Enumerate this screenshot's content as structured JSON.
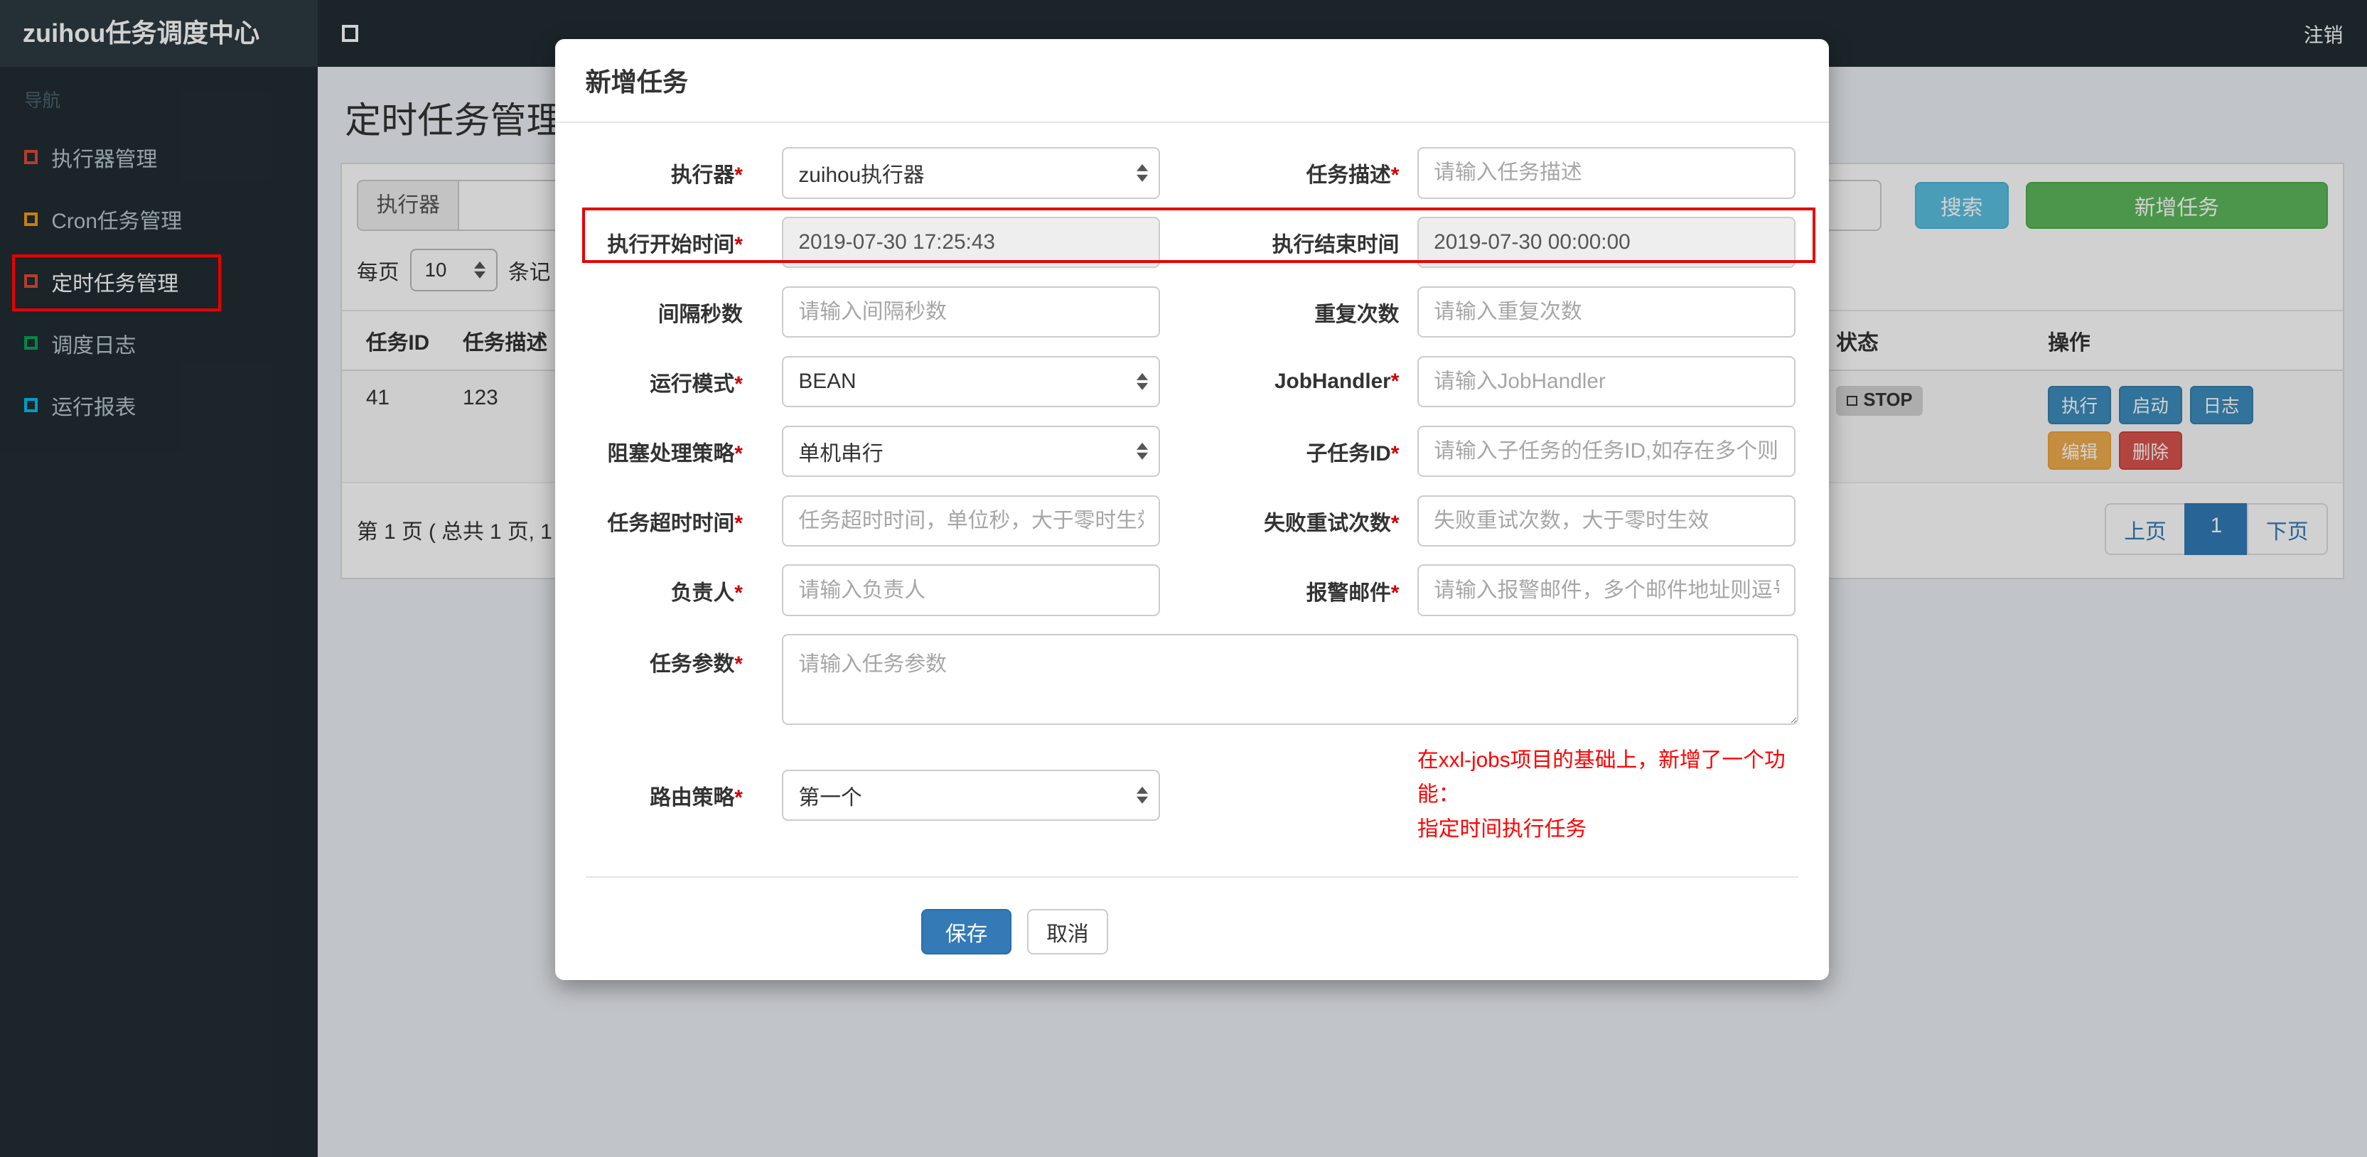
{
  "colors": {
    "topbar_bg": "#222d32",
    "sidebar_bg": "#222d32",
    "content_bg": "#ecf0f5",
    "primary_blue": "#337ab7",
    "action_blue": "#3c8dbc",
    "info_teal": "#5bc0de",
    "success_green": "#5cb85c",
    "warning_orange": "#f0ad4e",
    "danger_red": "#d9534f",
    "annotation_red": "#e60000",
    "note_red": "#ff0000"
  },
  "topbar": {
    "brand": "zuihou任务调度中心",
    "logout": "注销"
  },
  "sidebar": {
    "header": "导航",
    "items": [
      {
        "label": "执行器管理",
        "color": "#dd4b39"
      },
      {
        "label": "Cron任务管理",
        "color": "#f39c12"
      },
      {
        "label": "定时任务管理",
        "color": "#dd4b39"
      },
      {
        "label": "调度日志",
        "color": "#00a65a"
      },
      {
        "label": "运行报表",
        "color": "#00c0ef"
      }
    ]
  },
  "page": {
    "title": "定时任务管理",
    "toolbar": {
      "executor_label": "执行器",
      "search": "搜索",
      "add": "新增任务"
    },
    "per_page": {
      "label": "每页",
      "value": "10",
      "suffix": "条记"
    },
    "table": {
      "headers": {
        "id": "任务ID",
        "desc": "任务描述",
        "status": "状态",
        "ops": "操作"
      },
      "row": {
        "id": "41",
        "desc": "123",
        "status": "STOP",
        "btn_execute": "执行",
        "btn_start": "启动",
        "btn_log": "日志",
        "btn_edit": "编辑",
        "btn_delete": "删除"
      }
    },
    "footer": {
      "summary": "第 1 页 ( 总共 1 页, 1",
      "prev": "上页",
      "page": "1",
      "next": "下页"
    }
  },
  "modal": {
    "title": "新增任务",
    "required_mark": "*",
    "executor": {
      "label": "执行器",
      "value": "zuihou执行器"
    },
    "job_desc": {
      "label": "任务描述",
      "placeholder": "请输入任务描述"
    },
    "start_time": {
      "label": "执行开始时间",
      "value": "2019-07-30 17:25:43"
    },
    "end_time": {
      "label": "执行结束时间",
      "value": "2019-07-30 00:00:00"
    },
    "interval": {
      "label": "间隔秒数",
      "placeholder": "请输入间隔秒数"
    },
    "repeat": {
      "label": "重复次数",
      "placeholder": "请输入重复次数"
    },
    "run_mode": {
      "label": "运行模式",
      "value": "BEAN"
    },
    "job_handler": {
      "label": "JobHandler",
      "placeholder": "请输入JobHandler"
    },
    "block_strategy": {
      "label": "阻塞处理策略",
      "value": "单机串行"
    },
    "child_job_id": {
      "label": "子任务ID",
      "placeholder": "请输入子任务的任务ID,如存在多个则逗"
    },
    "timeout": {
      "label": "任务超时时间",
      "placeholder": "任务超时时间，单位秒，大于零时生效"
    },
    "fail_retry": {
      "label": "失败重试次数",
      "placeholder": "失败重试次数，大于零时生效"
    },
    "owner": {
      "label": "负责人",
      "placeholder": "请输入负责人"
    },
    "alarm_email": {
      "label": "报警邮件",
      "placeholder": "请输入报警邮件，多个邮件地址则逗号分"
    },
    "job_param": {
      "label": "任务参数",
      "placeholder": "请输入任务参数"
    },
    "route_strategy": {
      "label": "路由策略",
      "value": "第一个"
    },
    "note_line1": "在xxl-jobs项目的基础上，新增了一个功能：",
    "note_line2": "指定时间执行任务",
    "save": "保存",
    "cancel": "取消"
  }
}
